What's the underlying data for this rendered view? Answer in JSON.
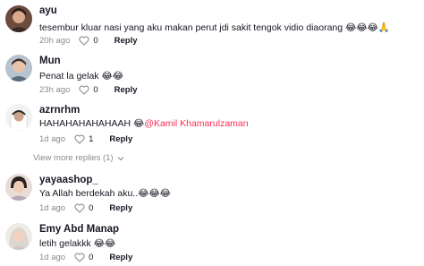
{
  "comments": [
    {
      "username": "ayu",
      "text": "tesembur kluar nasi yang aku makan perut jdi sakit tengok vidio diaorang 😂😂😂🙏",
      "time": "20h ago",
      "likes": "0",
      "reply": "Reply"
    },
    {
      "username": "Mun",
      "text": "Penat la gelak 😂😂",
      "time": "23h ago",
      "likes": "0",
      "reply": "Reply"
    },
    {
      "username": "azrnrhm",
      "text": "HAHAHAHAHAHAAH 😂",
      "mention": "@Kamil Khamarulzaman",
      "time": "1d ago",
      "likes": "1",
      "reply": "Reply"
    },
    {
      "username": "yayaashop_",
      "text": "Ya Allah berdekah aku..😂😂😂",
      "time": "1d ago",
      "likes": "0",
      "reply": "Reply"
    },
    {
      "username": "Emy Abd Manap",
      "text": "letih gelakkk 😂😂",
      "time": "1d ago",
      "likes": "0",
      "reply": "Reply"
    }
  ],
  "view_more": "View more replies (1)",
  "colors": {
    "mention": "#fe2c55",
    "muted": "#8a8b91",
    "text": "#161823"
  }
}
